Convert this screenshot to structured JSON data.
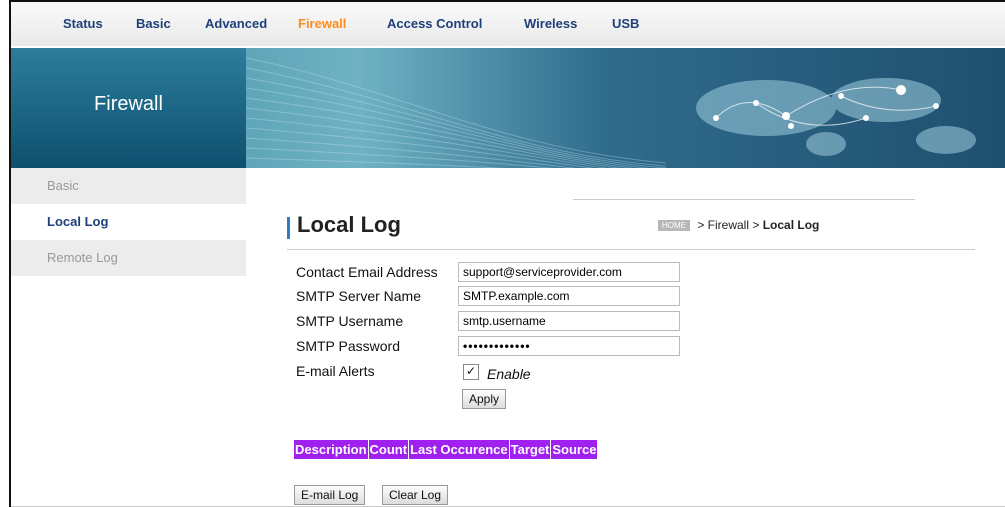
{
  "nav": {
    "items": [
      "Status",
      "Basic",
      "Advanced",
      "Firewall",
      "Access Control",
      "Wireless",
      "USB"
    ],
    "active_color": "#ff8c1a"
  },
  "banner": {
    "title": "Firewall"
  },
  "sidebar": {
    "items": [
      {
        "label": "Basic",
        "state": "muted"
      },
      {
        "label": "Local Log",
        "state": "active"
      },
      {
        "label": "Remote Log",
        "state": "muted"
      }
    ]
  },
  "page": {
    "title": "Local Log",
    "breadcrumb": {
      "home": "HOME",
      "path": " > Firewall > ",
      "current": "Local Log"
    }
  },
  "form": {
    "contact_email": {
      "label": "Contact Email Address",
      "value": "support@serviceprovider.com"
    },
    "smtp_server": {
      "label": "SMTP Server Name",
      "value": "SMTP.example.com"
    },
    "smtp_username": {
      "label": "SMTP Username",
      "value": "smtp.username"
    },
    "smtp_password": {
      "label": "SMTP Password",
      "value": "•••••••••••••"
    },
    "email_alerts": {
      "label": "E-mail Alerts",
      "checkbox_label": "Enable",
      "checked": true,
      "check_glyph": "✓"
    },
    "apply_label": "Apply"
  },
  "log_table": {
    "headers": [
      "Description",
      "Count",
      "Last Occurence",
      "Target",
      "Source"
    ],
    "header_color": "#a020f0"
  },
  "actions": {
    "email_log": "E-mail Log",
    "clear_log": "Clear Log"
  }
}
